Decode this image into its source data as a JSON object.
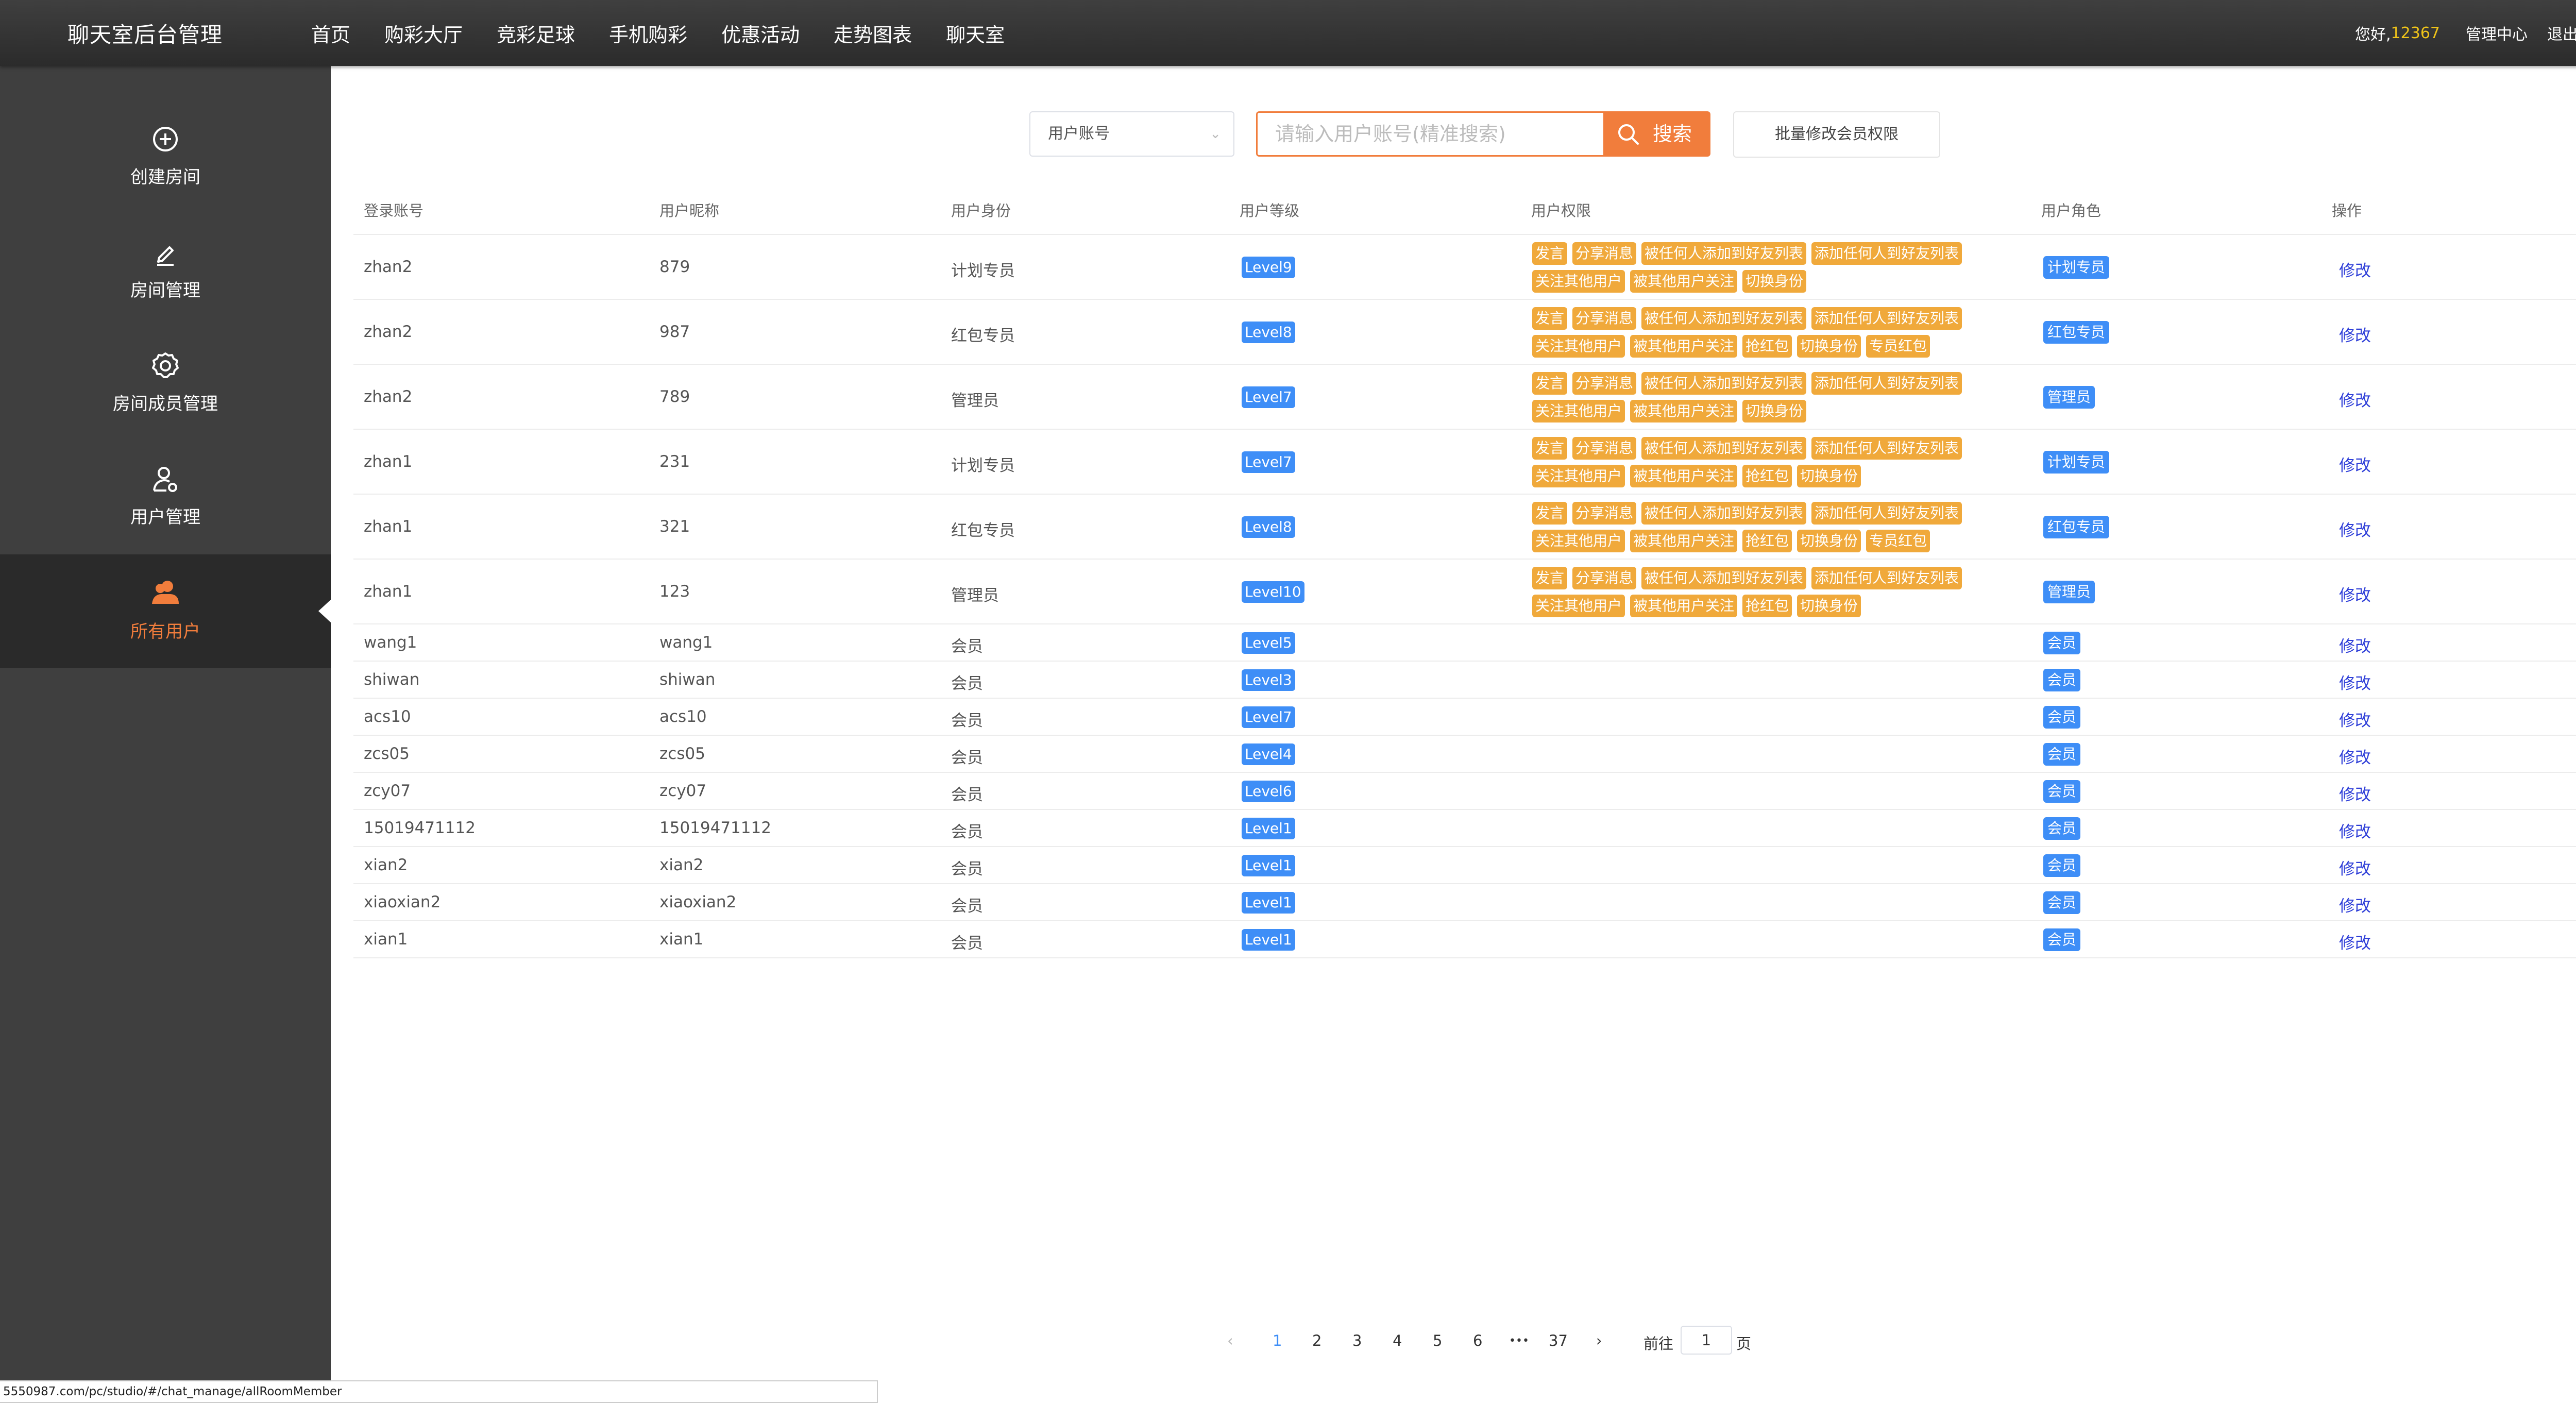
{
  "header": {
    "brand": "聊天室后台管理",
    "nav": [
      "首页",
      "购彩大厅",
      "竞彩足球",
      "手机购彩",
      "优惠活动",
      "走势图表",
      "聊天室"
    ],
    "greeting": "您好,",
    "user_id": "12367",
    "center_link": "管理中心",
    "logout_link": "退出"
  },
  "sidebar": {
    "items": [
      {
        "label": "创建房间",
        "icon": "plus-circle-icon"
      },
      {
        "label": "房间管理",
        "icon": "pencil-icon"
      },
      {
        "label": "房间成员管理",
        "icon": "gear-icon"
      },
      {
        "label": "用户管理",
        "icon": "user-settings-icon"
      },
      {
        "label": "所有用户",
        "icon": "users-icon",
        "active": true
      }
    ]
  },
  "search": {
    "select_value": "用户账号",
    "placeholder": "请输入用户账号(精准搜索)",
    "search_label": "搜索",
    "batch_label": "批量修改会员权限"
  },
  "table": {
    "headers": [
      "登录账号",
      "用户昵称",
      "用户身份",
      "用户等级",
      "用户权限",
      "用户角色",
      "操作"
    ],
    "edit_label": "修改",
    "rows": [
      {
        "account": "zhan2",
        "nickname": "879",
        "identity": "计划专员",
        "level": "Level9",
        "role": "计划专员",
        "permissions": [
          [
            "发言",
            "分享消息",
            "被任何人添加到好友列表",
            "添加任何人到好友列表"
          ],
          [
            "关注其他用户",
            "被其他用户关注",
            "切换身份"
          ]
        ]
      },
      {
        "account": "zhan2",
        "nickname": "987",
        "identity": "红包专员",
        "level": "Level8",
        "role": "红包专员",
        "permissions": [
          [
            "发言",
            "分享消息",
            "被任何人添加到好友列表",
            "添加任何人到好友列表"
          ],
          [
            "关注其他用户",
            "被其他用户关注",
            "抢红包",
            "切换身份",
            "专员红包"
          ]
        ]
      },
      {
        "account": "zhan2",
        "nickname": "789",
        "identity": "管理员",
        "level": "Level7",
        "role": "管理员",
        "permissions": [
          [
            "发言",
            "分享消息",
            "被任何人添加到好友列表",
            "添加任何人到好友列表"
          ],
          [
            "关注其他用户",
            "被其他用户关注",
            "切换身份"
          ]
        ]
      },
      {
        "account": "zhan1",
        "nickname": "231",
        "identity": "计划专员",
        "level": "Level7",
        "role": "计划专员",
        "permissions": [
          [
            "发言",
            "分享消息",
            "被任何人添加到好友列表",
            "添加任何人到好友列表"
          ],
          [
            "关注其他用户",
            "被其他用户关注",
            "抢红包",
            "切换身份"
          ]
        ]
      },
      {
        "account": "zhan1",
        "nickname": "321",
        "identity": "红包专员",
        "level": "Level8",
        "role": "红包专员",
        "permissions": [
          [
            "发言",
            "分享消息",
            "被任何人添加到好友列表",
            "添加任何人到好友列表"
          ],
          [
            "关注其他用户",
            "被其他用户关注",
            "抢红包",
            "切换身份",
            "专员红包"
          ]
        ]
      },
      {
        "account": "zhan1",
        "nickname": "123",
        "identity": "管理员",
        "level": "Level10",
        "role": "管理员",
        "permissions": [
          [
            "发言",
            "分享消息",
            "被任何人添加到好友列表",
            "添加任何人到好友列表"
          ],
          [
            "关注其他用户",
            "被其他用户关注",
            "抢红包",
            "切换身份"
          ]
        ]
      },
      {
        "account": "wang1",
        "nickname": "wang1",
        "identity": "会员",
        "level": "Level5",
        "role": "会员",
        "permissions": []
      },
      {
        "account": "shiwan",
        "nickname": "shiwan",
        "identity": "会员",
        "level": "Level3",
        "role": "会员",
        "permissions": []
      },
      {
        "account": "acs10",
        "nickname": "acs10",
        "identity": "会员",
        "level": "Level7",
        "role": "会员",
        "permissions": []
      },
      {
        "account": "zcs05",
        "nickname": "zcs05",
        "identity": "会员",
        "level": "Level4",
        "role": "会员",
        "permissions": []
      },
      {
        "account": "zcy07",
        "nickname": "zcy07",
        "identity": "会员",
        "level": "Level6",
        "role": "会员",
        "permissions": []
      },
      {
        "account": "15019471112",
        "nickname": "15019471112",
        "identity": "会员",
        "level": "Level1",
        "role": "会员",
        "permissions": []
      },
      {
        "account": "xian2",
        "nickname": "xian2",
        "identity": "会员",
        "level": "Level1",
        "role": "会员",
        "permissions": []
      },
      {
        "account": "xiaoxian2",
        "nickname": "xiaoxian2",
        "identity": "会员",
        "level": "Level1",
        "role": "会员",
        "permissions": []
      },
      {
        "account": "xian1",
        "nickname": "xian1",
        "identity": "会员",
        "level": "Level1",
        "role": "会员",
        "permissions": []
      }
    ]
  },
  "pagination": {
    "pages": [
      "1",
      "2",
      "3",
      "4",
      "5",
      "6",
      "•••",
      "37"
    ],
    "current": "1",
    "goto_label": "前往",
    "goto_value": "1",
    "page_suffix": "页"
  },
  "status_url": "5550987.com/pc/studio/#/chat_manage/allRoomMember",
  "colors": {
    "accent": "#f17d3c",
    "level_badge": "#3e8ef7",
    "permission_tag": "#f0a93b",
    "edit_link": "#2f3fd8"
  }
}
